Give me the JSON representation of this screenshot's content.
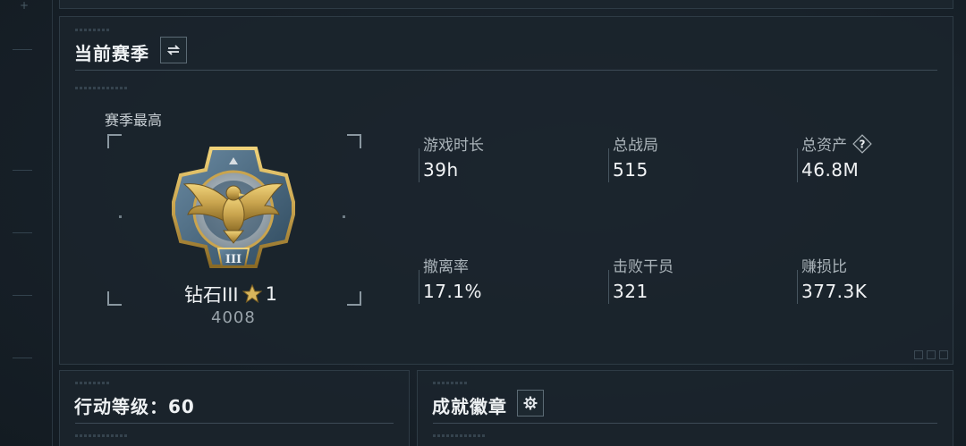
{
  "season": {
    "title": "当前赛季",
    "switch_icon": "swap-icon"
  },
  "season_best": {
    "label": "赛季最高",
    "rank_name": "钻石III",
    "star_icon": "star-icon",
    "stars": "1",
    "score": "4008",
    "emblem_numeral": "III"
  },
  "stats": [
    {
      "label": "游戏时长",
      "value": "39h"
    },
    {
      "label": "总战局",
      "value": "515"
    },
    {
      "label": "总资产",
      "value": "46.8M",
      "help_icon": "question-icon"
    },
    {
      "label": "撤离率",
      "value": "17.1%"
    },
    {
      "label": "击败干员",
      "value": "321"
    },
    {
      "label": "赚损比",
      "value": "377.3K"
    }
  ],
  "action_level": {
    "title": "行动等级：60"
  },
  "achievements": {
    "title": "成就徽章",
    "settings_icon": "gear-icon"
  },
  "colors": {
    "background": "#1a232b",
    "panel_border": "#2e3b45",
    "text_primary": "#eef1f3",
    "text_secondary": "#aab3b9",
    "emblem_gold": "#c9a44e",
    "emblem_steel": "#4a6a82"
  }
}
